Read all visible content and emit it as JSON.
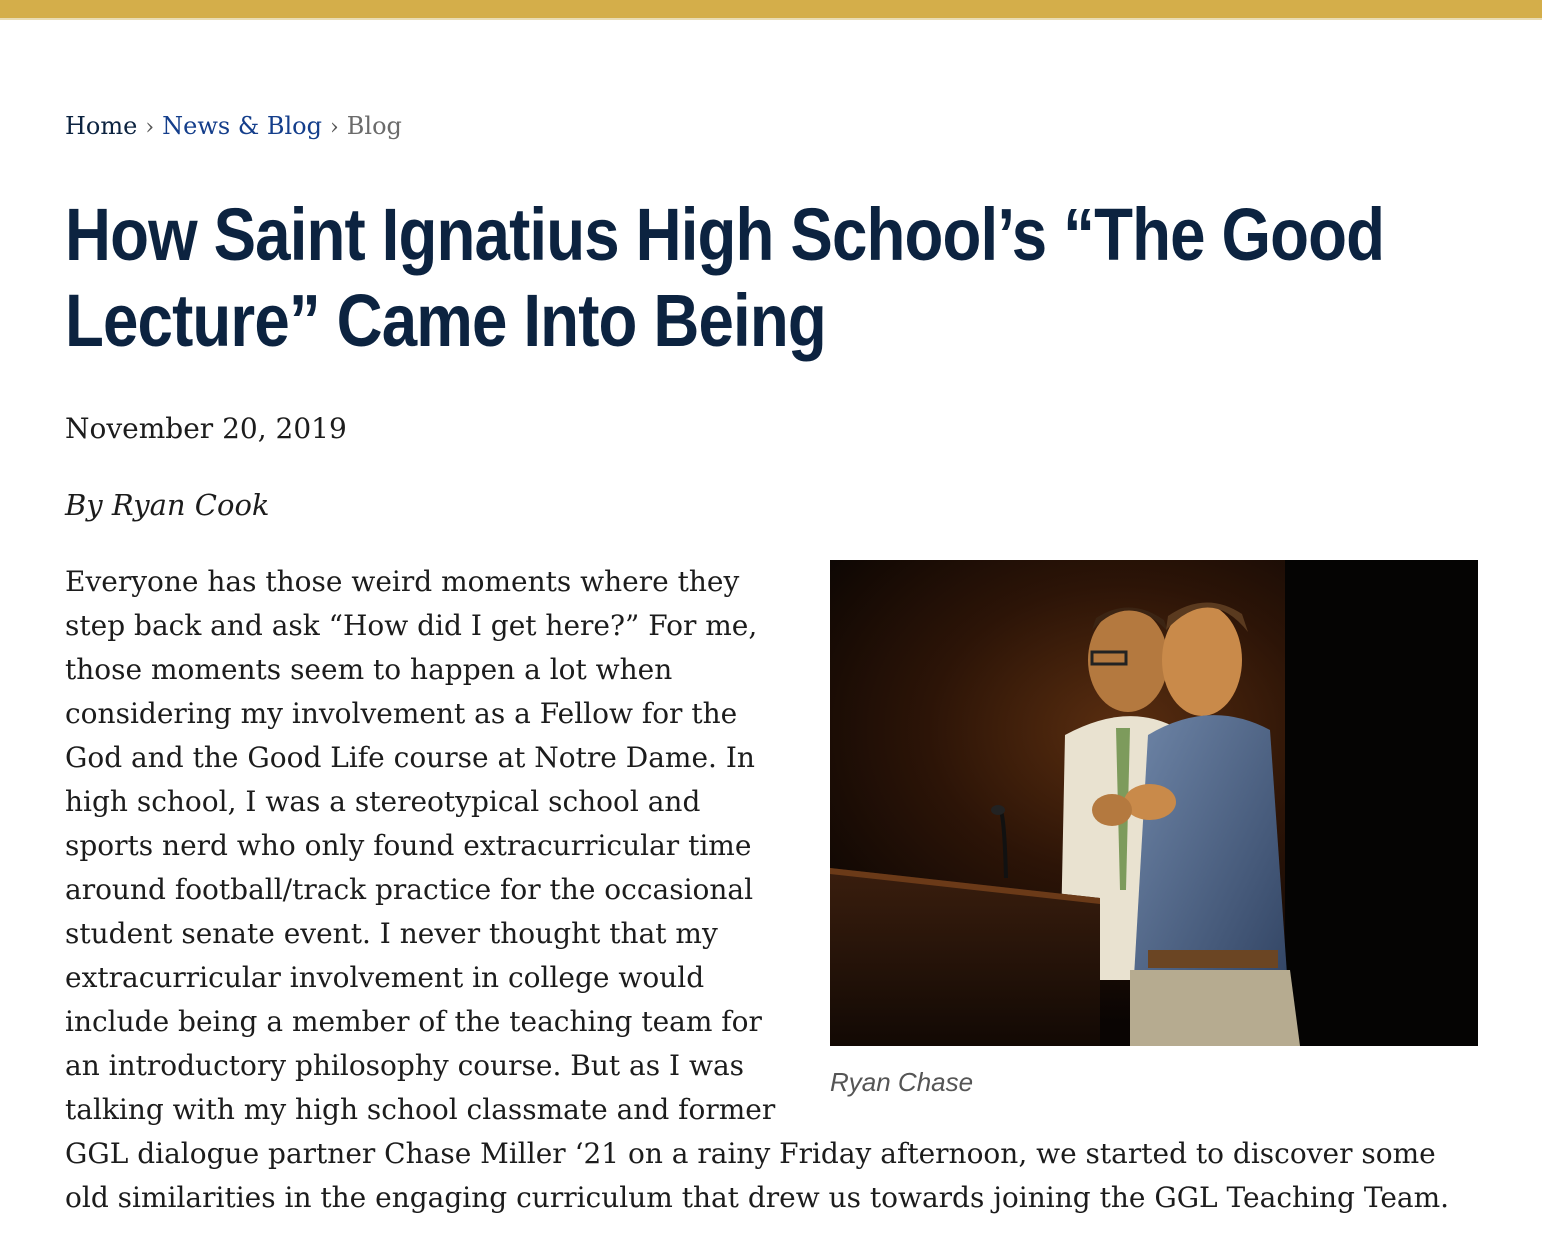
{
  "breadcrumb": {
    "home": "Home",
    "section": "News & Blog",
    "current": "Blog",
    "separator": "›"
  },
  "article": {
    "title": "How Saint Ignatius High School’s “The Good Lecture” Came Into Being",
    "date": "November 20, 2019",
    "byline": "By Ryan Cook",
    "image_caption": "Ryan Chase",
    "body": "Everyone has those weird moments where they step back and ask “How did I get here?” For me, those moments seem to happen a lot when considering my involvement as a Fellow for the God and the Good Life course at Notre Dame. In high school, I was a stereotypical school and sports nerd who only found extracurricular time around football/track practice for the occasional student senate event. I never thought that my extracurricular involvement in college would include being a member of the teaching team for an introductory philosophy course.  But as I was talking with my high school classmate and former GGL dialogue partner Chase Miller ‘21 on a rainy Friday afternoon, we started to discover some old similarities in the engaging curriculum that drew us towards joining the GGL Teaching Team."
  },
  "colors": {
    "accent_bar": "#d4ae4a",
    "title": "#0c2340",
    "link": "#143e8b"
  }
}
